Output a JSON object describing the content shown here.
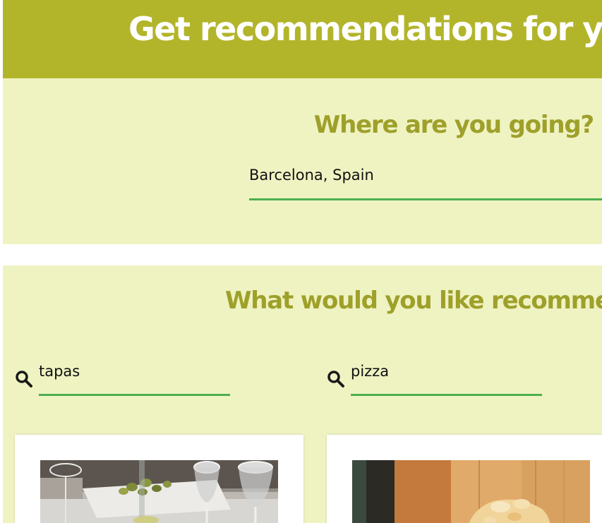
{
  "header": {
    "title": "Get recommendations for you"
  },
  "destination": {
    "heading": "Where are you going?",
    "input_value": "Barcelona, Spain"
  },
  "recommendations": {
    "heading": "What would you like recommenda",
    "searches": [
      {
        "icon": "search-icon",
        "value": "tapas"
      },
      {
        "icon": "search-icon",
        "value": "pizza"
      }
    ]
  },
  "colors": {
    "header_bg": "#b2b52a",
    "section_bg": "#eff3c2",
    "heading": "#9ea02a",
    "underline": "#4caf50"
  }
}
